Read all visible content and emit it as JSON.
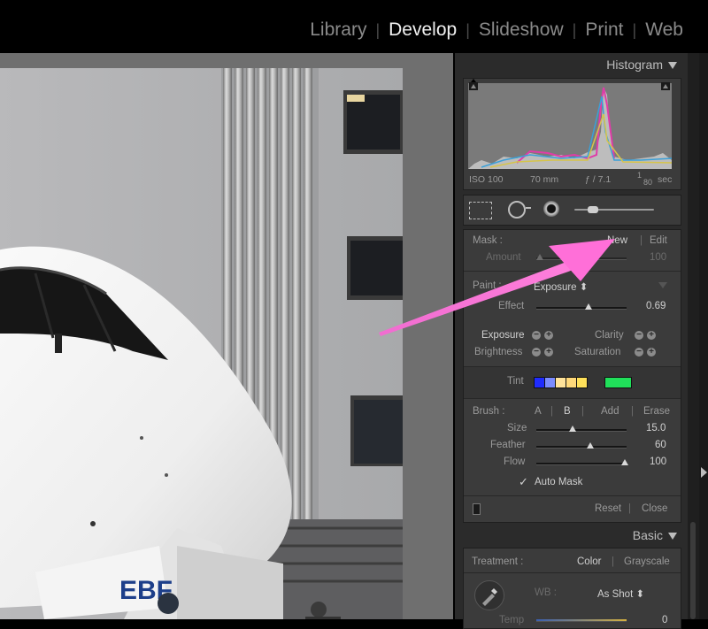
{
  "modules": [
    "Library",
    "Develop",
    "Slideshow",
    "Print",
    "Web"
  ],
  "active_module": "Develop",
  "histogram": {
    "title": "Histogram",
    "info": {
      "iso": "ISO 100",
      "focal": "70 mm",
      "aperture": "ƒ / 7.1",
      "shutter_num": "1",
      "shutter_den": "80",
      "shutter_unit": "sec"
    }
  },
  "brush": {
    "mask_label": "Mask :",
    "new_label": "New",
    "edit_label": "Edit",
    "amount_label": "Amount",
    "amount_value": "100",
    "paint_label": "Paint :",
    "paint_value": "Exposure",
    "effect_label": "Effect",
    "effect_value": "0.69",
    "effect_pos": 0.58,
    "exposure_label": "Exposure",
    "clarity_label": "Clarity",
    "brightness_label": "Brightness",
    "saturation_label": "Saturation",
    "tint_label": "Tint",
    "tint_colors": [
      "#1f2cff",
      "#7b8cff",
      "#ffe39a",
      "#ffd97a",
      "#ffe15a",
      "#20e05a"
    ],
    "brush_label": "Brush :",
    "a_label": "A",
    "b_label": "B",
    "add_label": "Add",
    "erase_label": "Erase",
    "size_label": "Size",
    "size_value": "15.0",
    "size_pos": 0.4,
    "feather_label": "Feather",
    "feather_value": "60",
    "feather_pos": 0.6,
    "flow_label": "Flow",
    "flow_value": "100",
    "flow_pos": 0.98,
    "automask_label": "Auto Mask",
    "automask_checked": true,
    "reset_label": "Reset",
    "close_label": "Close"
  },
  "basic": {
    "title": "Basic",
    "treatment_label": "Treatment :",
    "color_label": "Color",
    "grayscale_label": "Grayscale",
    "wb_label": "WB :",
    "wb_value": "As Shot",
    "temp_label": "Temp",
    "temp_value": "0"
  },
  "photo": {
    "tail_text": "EBF"
  }
}
